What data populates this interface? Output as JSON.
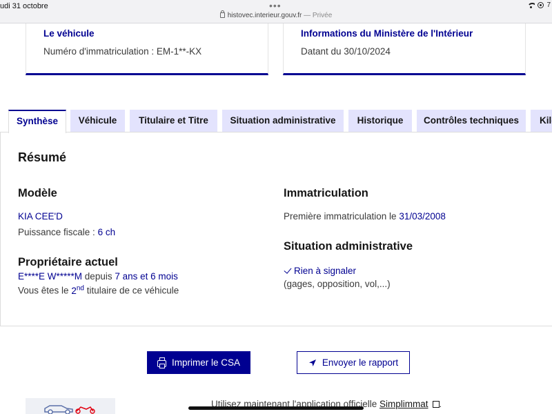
{
  "status_bar": {
    "date": "udi 31 octobre",
    "dots": "•••",
    "url": "histovec.interieur.gouv.fr",
    "private_label": "— Privée",
    "battery": "7"
  },
  "cards": {
    "vehicle": {
      "title": "Le véhicule",
      "text": "Numéro d'immatriculation : EM-1**-KX"
    },
    "ministry": {
      "title": "Informations du Ministère de l'Intérieur",
      "text": "Datant du 30/10/2024"
    }
  },
  "tabs": [
    {
      "label": "Synthèse",
      "active": true
    },
    {
      "label": "Véhicule"
    },
    {
      "label": "Titulaire et Titre"
    },
    {
      "label": "Situation administrative"
    },
    {
      "label": "Historique"
    },
    {
      "label": "Contrôles techniques"
    },
    {
      "label": "Kilo"
    }
  ],
  "summary": {
    "heading": "Résumé",
    "model": {
      "heading": "Modèle",
      "name": "KIA CEE'D",
      "power_label": "Puissance fiscale :",
      "power_value": "6 ch"
    },
    "owner": {
      "heading": "Propriétaire actuel",
      "name": "E****E W*****M",
      "since_label": "depuis",
      "since_value": "7 ans et 6 mois",
      "rank_prefix": "Vous êtes le",
      "rank_number": "2",
      "rank_suffix": "nd",
      "rank_rest": "titulaire de ce véhicule"
    },
    "registration": {
      "heading": "Immatriculation",
      "first_label": "Première immatriculation le",
      "first_date": "31/03/2008"
    },
    "admin": {
      "heading": "Situation administrative",
      "status": "Rien à signaler",
      "detail": "(gages, opposition, vol,...)"
    }
  },
  "actions": {
    "print_label": "Imprimer le CSA",
    "send_label": "Envoyer le rapport"
  },
  "footer": {
    "text": "Utilisez maintenant l'application officielle",
    "link": "Simplimmat",
    "end": "."
  },
  "colors": {
    "accent": "#000091",
    "tab_bg": "#e3e3fd"
  },
  "icons": [
    "lock-icon",
    "wifi-icon",
    "printer-icon",
    "send-icon",
    "check-icon",
    "external-link-icon",
    "vehicles-icon"
  ]
}
